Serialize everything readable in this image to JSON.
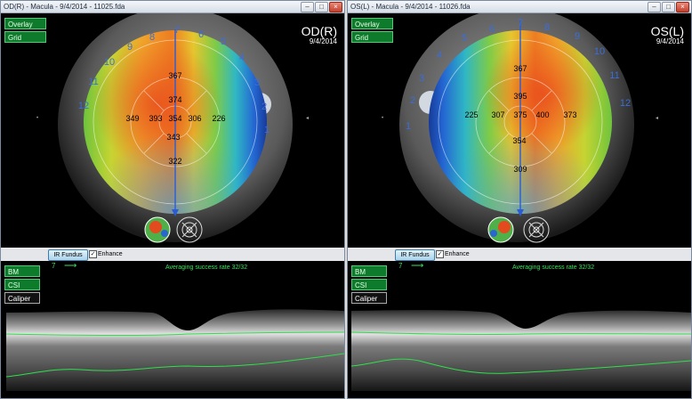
{
  "windows": [
    {
      "title": "OD(R) - Macula - 9/4/2014 - 11025.fda",
      "overlay_label": "Overlay",
      "grid_label": "Grid",
      "eye_label": "OD(R)",
      "date": "9/4/2014",
      "thickness": {
        "top": "367",
        "upper": "374",
        "left_outer": "349",
        "left_inner": "393",
        "center": "354",
        "right_inner": "306",
        "right_outer": "226",
        "lower": "343",
        "bottom": "322"
      },
      "ir_fundus_label": "IR Fundus",
      "enhance_label": "Enhance",
      "slice_number": "7",
      "averaging_text": "Averaging success rate  32/32",
      "layer_buttons": [
        "BM",
        "CSI",
        "Caliper"
      ]
    },
    {
      "title": "OS(L) - Macula - 9/4/2014 - 11026.fda",
      "overlay_label": "Overlay",
      "grid_label": "Grid",
      "eye_label": "OS(L)",
      "date": "9/4/2014",
      "thickness": {
        "top": "367",
        "upper": "395",
        "left_outer": "225",
        "left_inner": "307",
        "center": "375",
        "right_inner": "400",
        "right_outer": "373",
        "lower": "354",
        "bottom": "309"
      },
      "ir_fundus_label": "IR Fundus",
      "enhance_label": "Enhance",
      "slice_number": "7",
      "averaging_text": "Averaging success rate  32/32",
      "layer_buttons": [
        "BM",
        "CSI",
        "Caliper"
      ]
    }
  ],
  "sector_labels": [
    "1",
    "2",
    "3",
    "4",
    "5",
    "6",
    "7",
    "8",
    "9",
    "10",
    "11",
    "12"
  ],
  "window_buttons": {
    "minimize": "–",
    "maximize": "□",
    "close": "×"
  },
  "enhance_checked": "✓",
  "colors": {
    "overlay_button": "#0e7a2c",
    "scan_line": "#2a5cd6",
    "oct_segmentation": "#2ee04a",
    "ir_fundus_button": "#a9d3ec"
  }
}
